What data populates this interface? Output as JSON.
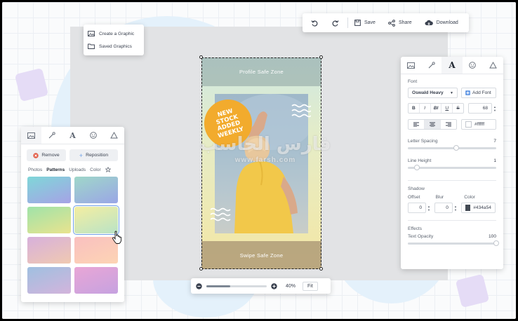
{
  "toolbar": {
    "undo_icon": "undo-icon",
    "redo_icon": "redo-icon",
    "save_label": "Save",
    "share_label": "Share",
    "download_label": "Download"
  },
  "graphic_menu": {
    "items": [
      {
        "label": "Create a Graphic",
        "icon": "image-icon"
      },
      {
        "label": "Saved Graphics",
        "icon": "folder-icon"
      }
    ]
  },
  "poster": {
    "profile_zone": "Profile Safe Zone",
    "swipe_zone": "Swipe Safe Zone",
    "badge_text": "NEW STOCK ADDED WEEKLY",
    "badge_color": "#f2ab2d"
  },
  "zoom": {
    "value": "40%",
    "fit_label": "Fit",
    "level": 0.4
  },
  "bg_panel": {
    "tabs": [
      "image-icon",
      "wand-icon",
      "text-icon",
      "emoji-icon",
      "shape-icon"
    ],
    "remove_label": "Remove",
    "reposition_label": "Reposition",
    "subtabs": [
      "Photos",
      "Patterns",
      "Uploads",
      "Color"
    ],
    "active_subtab": "Patterns",
    "swatches": [
      {
        "from": "#7fd7d8",
        "to": "#a6a2e6"
      },
      {
        "from": "#9fd7c9",
        "to": "#9aa6e6"
      },
      {
        "from": "#9fe3a9",
        "to": "#e9e38e"
      },
      {
        "from": "#f4eea1",
        "to": "#b9e3c6"
      },
      {
        "from": "#d7b0dc",
        "to": "#f0c9b1"
      },
      {
        "from": "#f9c0c0",
        "to": "#fdd4b4"
      },
      {
        "from": "#9fc0e0",
        "to": "#d3b4dc"
      },
      {
        "from": "#e9a6d6",
        "to": "#c6a2e0"
      }
    ]
  },
  "text_panel": {
    "tabs": [
      "image-icon",
      "wand-icon",
      "text-icon",
      "emoji-icon",
      "shape-icon"
    ],
    "font_label": "Font",
    "font_value": "Oswald Heavy",
    "add_font_label": "Add Font",
    "style_buttons": [
      "B",
      "I",
      "BI",
      "U",
      "S"
    ],
    "font_size": "68",
    "text_color": "#ffffff",
    "letter_spacing_label": "Letter Spacing",
    "letter_spacing_value": "7",
    "letter_spacing_level": 0.55,
    "line_height_label": "Line Height",
    "line_height_value": "1",
    "line_height_level": 0.1,
    "shadow_label": "Shadow",
    "offset_label": "Offset",
    "offset_value": "0",
    "blur_label": "Blur",
    "blur_value": "0",
    "color_label": "Color",
    "shadow_color": "#434a54",
    "effects_label": "Effects",
    "text_opacity_label": "Text Opacity",
    "text_opacity_value": "100",
    "text_opacity_level": 1.0
  },
  "watermark": {
    "line1": "فارس الحاسب",
    "line2": "www.farsh.com"
  }
}
